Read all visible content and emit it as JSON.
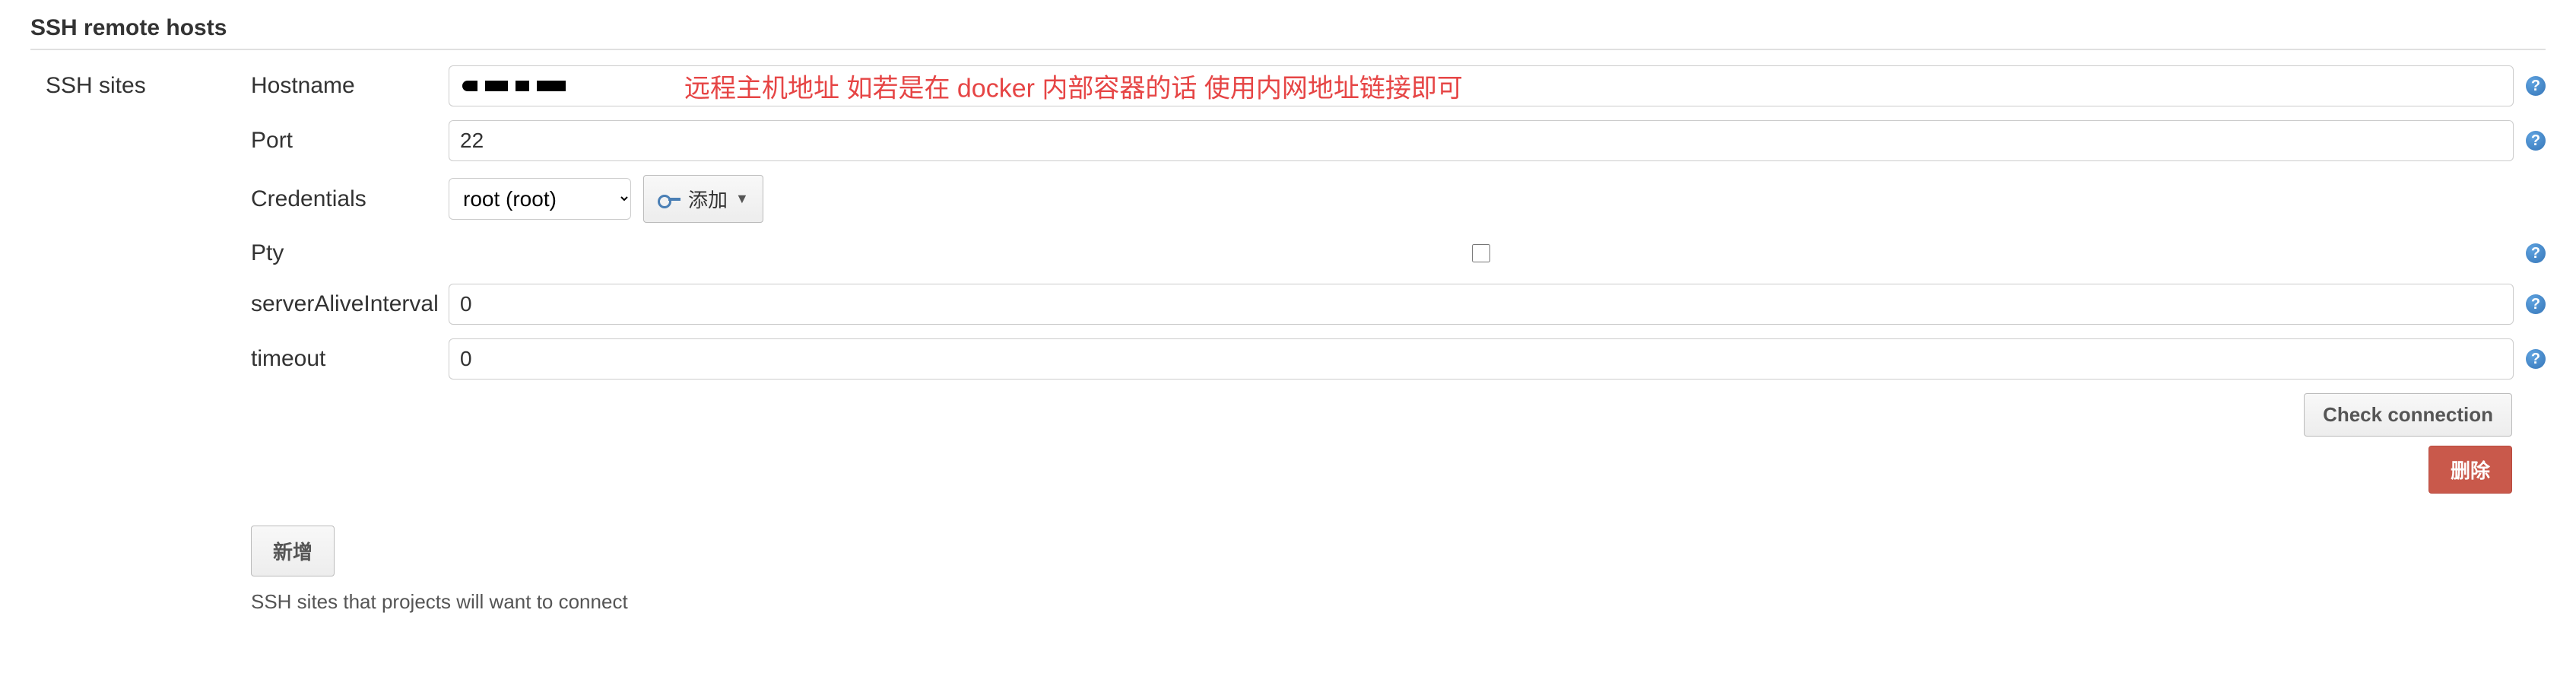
{
  "section": {
    "title": "SSH remote hosts",
    "left_label": "SSH sites"
  },
  "form": {
    "hostname": {
      "label": "Hostname",
      "value": "",
      "annotation": "远程主机地址 如若是在 docker 内部容器的话 使用内网地址链接即可"
    },
    "port": {
      "label": "Port",
      "value": "22"
    },
    "credentials": {
      "label": "Credentials",
      "selected": "root (root)",
      "add_label": "添加"
    },
    "pty": {
      "label": "Pty",
      "checked": false
    },
    "serverAliveInterval": {
      "label": "serverAliveInterval",
      "value": "0"
    },
    "timeout": {
      "label": "timeout",
      "value": "0"
    }
  },
  "actions": {
    "check_connection": "Check connection",
    "delete": "删除",
    "add_new": "新增"
  },
  "description": "SSH sites that projects will want to connect",
  "help_icon": "?"
}
